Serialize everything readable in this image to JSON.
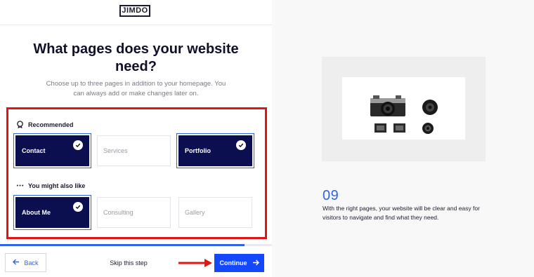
{
  "header": {
    "logo_text": "JIMDO"
  },
  "main": {
    "title": "What pages does your website need?",
    "subtitle": "Choose up to three pages in addition to your homepage. You can always add or make changes later on."
  },
  "sections": {
    "recommended": {
      "label": "Recommended",
      "icon": "badge-icon",
      "cards": [
        {
          "label": "Contact",
          "selected": true
        },
        {
          "label": "Services",
          "selected": false
        },
        {
          "label": "Portfolio",
          "selected": true
        }
      ]
    },
    "also_like": {
      "label": "You might also like",
      "icon": "more-dots-icon",
      "cards": [
        {
          "label": "About Me",
          "selected": true
        },
        {
          "label": "Consulting",
          "selected": false
        },
        {
          "label": "Gallery",
          "selected": false
        }
      ]
    }
  },
  "progress": {
    "fraction": 0.9
  },
  "footer": {
    "back_label": "Back",
    "skip_label": "Skip this step",
    "continue_label": "Continue"
  },
  "side_panel": {
    "step_number": "09",
    "description": "With the right pages, your website will be clear and easy for visitors to navigate and find what they need.",
    "image_subject": "camera-lens-flatlay"
  },
  "annotations": {
    "highlight_color": "#e01616",
    "arrow_color": "#e01616"
  },
  "colors": {
    "navy": "#0b0e4f",
    "accent": "#1448ff",
    "blue": "#2f64e8"
  }
}
